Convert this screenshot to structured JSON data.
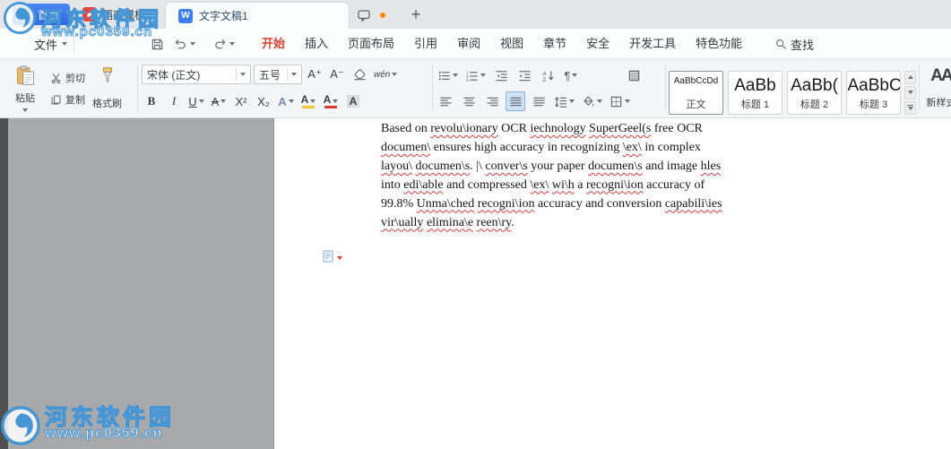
{
  "watermark": {
    "name": "河东软件园",
    "url": "www.pc0359.cn"
  },
  "titlebar": {
    "home": "首页",
    "docer_tab": "稻壳模板",
    "doc_tab": "文字文稿1",
    "new_tab": "+"
  },
  "menubar": {
    "file": "文件",
    "tabs": [
      "开始",
      "插入",
      "页面布局",
      "引用",
      "审阅",
      "视图",
      "章节",
      "安全",
      "开发工具",
      "特色功能"
    ],
    "active_tab": "开始",
    "find": "查找"
  },
  "ribbon": {
    "paste": "粘贴",
    "cut": "剪切",
    "copy": "复制",
    "format_painter": "格式刷",
    "font_family": "宋体 (正文)",
    "font_size": "五号",
    "glyphs": {
      "grow": "A⁺",
      "shrink": "A⁻",
      "pinyin": "wén",
      "bold": "B",
      "italic": "I",
      "underline": "U",
      "strike": "A",
      "superscript": "X²",
      "subscript": "X₂",
      "effects": "A",
      "highlight": "A",
      "font_color": "A",
      "shading": "A",
      "new_style_icon": "AA"
    },
    "styles": [
      {
        "preview": "AaBbCcDd",
        "label": "正文",
        "size": "sm",
        "selected": true
      },
      {
        "preview": "AaBb",
        "label": "标题 1",
        "size": "lg",
        "selected": false
      },
      {
        "preview": "AaBb(",
        "label": "标题 2",
        "size": "lg",
        "selected": false
      },
      {
        "preview": "AaBbC",
        "label": "标题 3",
        "size": "lg",
        "selected": false
      }
    ],
    "new_style": "新样式"
  },
  "document": {
    "lines": [
      [
        {
          "t": "Based on "
        },
        {
          "t": "revolu\\ionary",
          "err": true
        },
        {
          "t": " OCR "
        },
        {
          "t": "iechnology",
          "err": true
        },
        {
          "t": " "
        },
        {
          "t": "SuperGeel(s",
          "err": true
        },
        {
          "t": " free OCR"
        }
      ],
      [
        {
          "t": "documen\\",
          "err": true
        },
        {
          "t": " ensures high accuracy in recognizing "
        },
        {
          "t": "\\ex\\",
          "err": true
        },
        {
          "t": " in complex"
        }
      ],
      [
        {
          "t": "layou\\",
          "err": true
        },
        {
          "t": " "
        },
        {
          "t": "documen\\s",
          "err": true
        },
        {
          "t": ". |\\ "
        },
        {
          "t": "conver\\s",
          "err": true
        },
        {
          "t": " your paper "
        },
        {
          "t": "documen\\s",
          "err": true
        },
        {
          "t": " and image "
        },
        {
          "t": "hles",
          "err": true
        }
      ],
      [
        {
          "t": "into "
        },
        {
          "t": "edi\\able",
          "err": true
        },
        {
          "t": " and compressed "
        },
        {
          "t": "\\ex\\",
          "err": true
        },
        {
          "t": " "
        },
        {
          "t": "wi\\h",
          "err": true
        },
        {
          "t": " a "
        },
        {
          "t": "recogni\\ion",
          "err": true
        },
        {
          "t": " accuracy of"
        }
      ],
      [
        {
          "t": "99.8% "
        },
        {
          "t": "Unma\\ched",
          "err": true
        },
        {
          "t": " "
        },
        {
          "t": "recogni\\ion",
          "err": true
        },
        {
          "t": " accuracy and conversion "
        },
        {
          "t": "capabili\\ies",
          "err": true
        }
      ],
      [
        {
          "t": "vir\\ually",
          "err": true
        },
        {
          "t": " "
        },
        {
          "t": "elimina\\e",
          "err": true
        },
        {
          "t": " "
        },
        {
          "t": "reen\\ry",
          "err": true
        },
        {
          "t": "."
        }
      ]
    ]
  },
  "colors": {
    "accent_blue": "#3d7ef2",
    "active_tab_red": "#d9442e",
    "docer_red": "#eb4537",
    "dot_orange": "#ff8a00",
    "highlight_yellow": "#f7c52d",
    "font_color_red": "#d03a2b",
    "spell_wavy": "#e03a3a",
    "watermark_blue": "#4696d6"
  }
}
